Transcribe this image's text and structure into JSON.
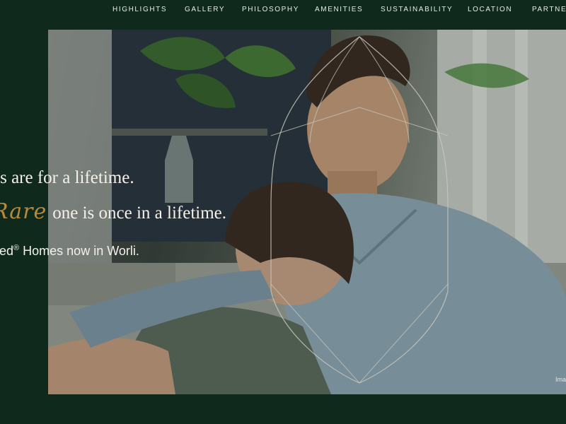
{
  "nav": {
    "items": [
      "HIGHLIGHTS",
      "GALLERY",
      "PHILOSOPHY",
      "AMENITIES",
      "SUSTAINABILITY",
      "LOCATION",
      "PARTNERS"
    ]
  },
  "hero": {
    "line1": "es are for a lifetime.",
    "line2_script": "Rare",
    "line2_rest": "one is once in a lifetime.",
    "line3_prefix": "ned",
    "line3_reg": "®",
    "line3_rest": " Homes now in Worli.",
    "caption": "Ima"
  },
  "colors": {
    "background": "#0f2a1c",
    "accent_gold": "#b58a3c",
    "text_light": "#f3f1ea"
  }
}
